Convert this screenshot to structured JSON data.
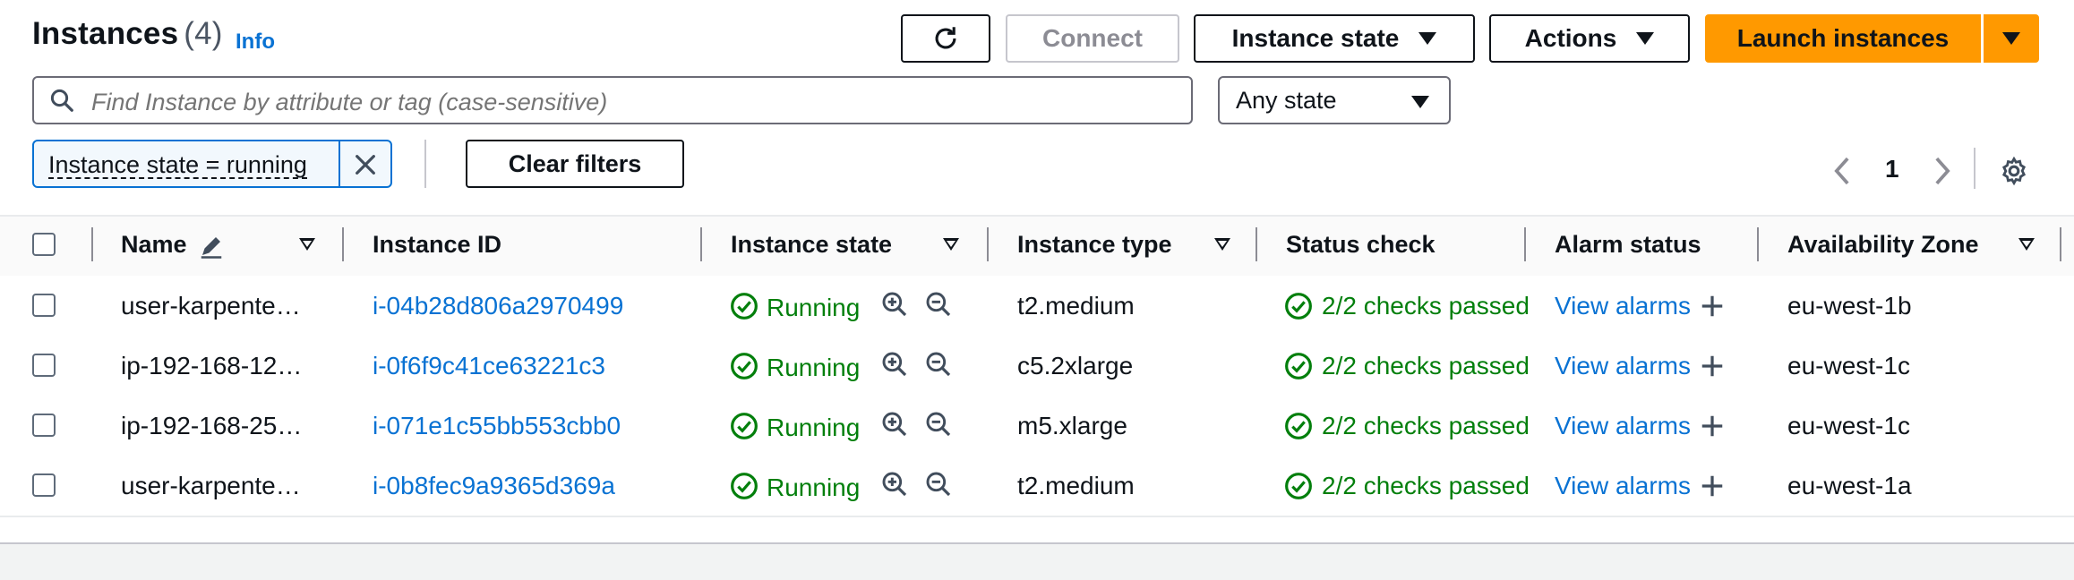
{
  "header": {
    "title": "Instances",
    "count": "(4)",
    "info_label": "Info",
    "connect_label": "Connect",
    "instance_state_label": "Instance state",
    "actions_label": "Actions",
    "launch_label": "Launch instances"
  },
  "search": {
    "placeholder": "Find Instance by attribute or tag (case-sensitive)",
    "state_filter": "Any state"
  },
  "filters": {
    "token": "Instance state = running",
    "clear_label": "Clear filters"
  },
  "pagination": {
    "page": "1"
  },
  "table": {
    "columns": [
      "Name",
      "Instance ID",
      "Instance state",
      "Instance type",
      "Status check",
      "Alarm status",
      "Availability Zone"
    ],
    "rows": [
      {
        "name": "user-karpente…",
        "id": "i-04b28d806a2970499",
        "state": "Running",
        "type": "t2.medium",
        "status": "2/2 checks passed",
        "alarm": "View alarms",
        "zone": "eu-west-1b"
      },
      {
        "name": "ip-192-168-12…",
        "id": "i-0f6f9c41ce63221c3",
        "state": "Running",
        "type": "c5.2xlarge",
        "status": "2/2 checks passed",
        "alarm": "View alarms",
        "zone": "eu-west-1c"
      },
      {
        "name": "ip-192-168-25…",
        "id": "i-071e1c55bb553cbb0",
        "state": "Running",
        "type": "m5.xlarge",
        "status": "2/2 checks passed",
        "alarm": "View alarms",
        "zone": "eu-west-1c"
      },
      {
        "name": "user-karpente…",
        "id": "i-0b8fec9a9365d369a",
        "state": "Running",
        "type": "t2.medium",
        "status": "2/2 checks passed",
        "alarm": "View alarms",
        "zone": "eu-west-1a"
      }
    ]
  },
  "colors": {
    "link": "#0972d3",
    "success": "#037f0c",
    "primary_button": "#ff9900"
  }
}
